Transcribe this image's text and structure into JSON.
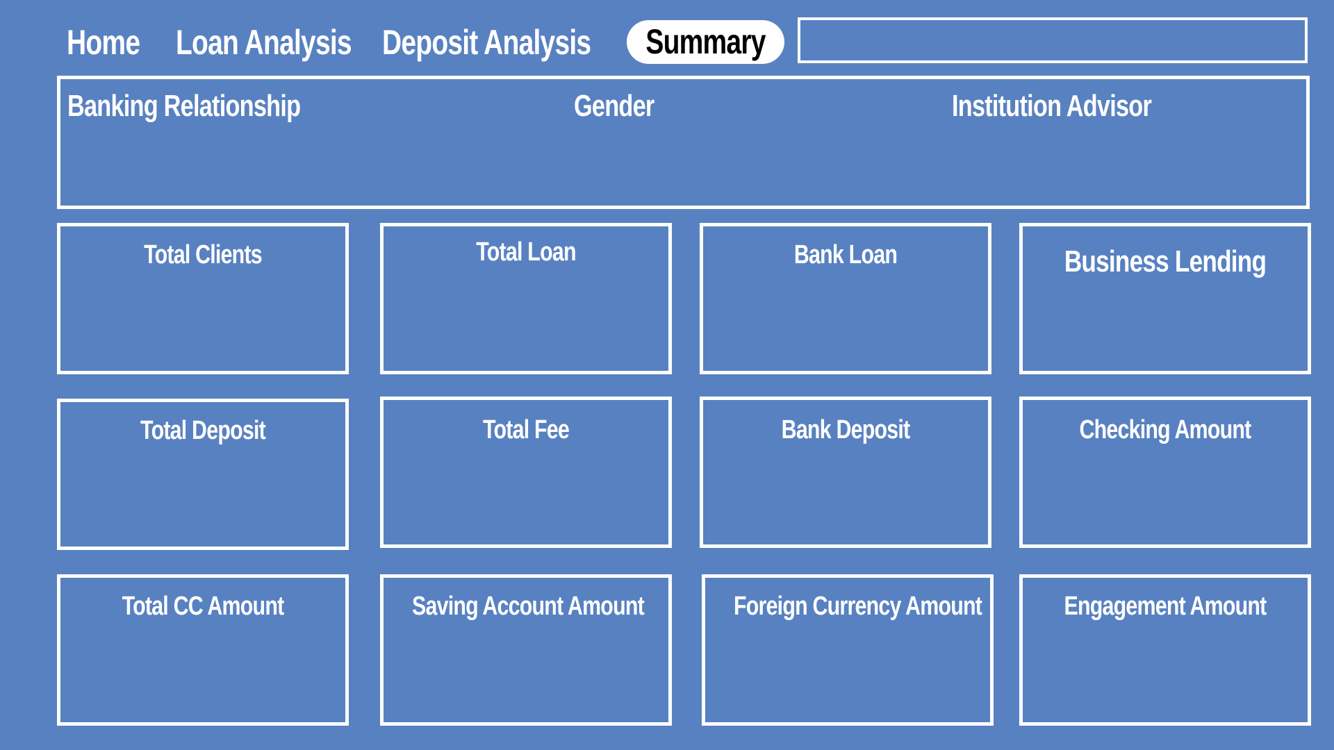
{
  "nav": {
    "home": "Home",
    "loan_analysis": "Loan Analysis",
    "deposit_analysis": "Deposit Analysis",
    "summary": "Summary"
  },
  "filters": {
    "banking_relationship": "Banking Relationship",
    "gender": "Gender",
    "institution_advisor": "Institution Advisor"
  },
  "cards": {
    "total_clients": "Total Clients",
    "total_loan": "Total Loan",
    "bank_loan": "Bank Loan",
    "business_lending": "Business Lending",
    "total_deposit": "Total Deposit",
    "total_fee": "Total Fee",
    "bank_deposit": "Bank Deposit",
    "checking_amount": "Checking Amount",
    "total_cc_amount": "Total CC Amount",
    "saving_account_amount": "Saving Account Amount",
    "foreign_currency_amount": "Foreign Currency Amount",
    "engagement_amount": "Engagement Amount"
  },
  "colors": {
    "background": "#5881c1",
    "border": "#ffffff",
    "active_tab_bg": "#ffffff",
    "active_tab_text": "#000000"
  }
}
